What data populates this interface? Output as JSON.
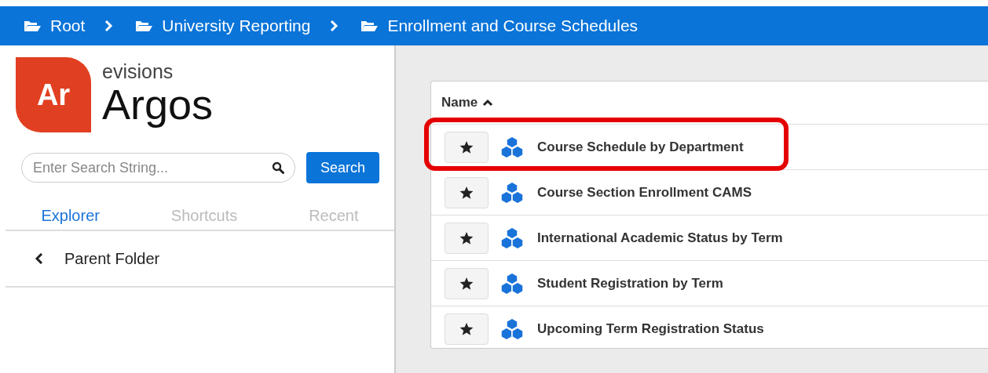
{
  "breadcrumbs": [
    {
      "label": "Root"
    },
    {
      "label": "University Reporting"
    },
    {
      "label": "Enrollment and Course Schedules"
    }
  ],
  "logo": {
    "mark": "Ar",
    "company": "evisions",
    "product": "Argos"
  },
  "search": {
    "placeholder": "Enter Search String...",
    "button": "Search"
  },
  "tabs": [
    {
      "label": "Explorer",
      "selected": true
    },
    {
      "label": "Shortcuts",
      "selected": false
    },
    {
      "label": "Recent",
      "selected": false
    }
  ],
  "parent_folder": "Parent Folder",
  "table": {
    "column": "Name",
    "rows": [
      {
        "name": "Course Schedule by Department",
        "highlighted": true
      },
      {
        "name": "Course Section Enrollment CAMS",
        "highlighted": false
      },
      {
        "name": "International Academic Status by Term",
        "highlighted": false
      },
      {
        "name": "Student Registration by Term",
        "highlighted": false
      },
      {
        "name": "Upcoming Term Registration Status",
        "highlighted": false
      }
    ]
  }
}
